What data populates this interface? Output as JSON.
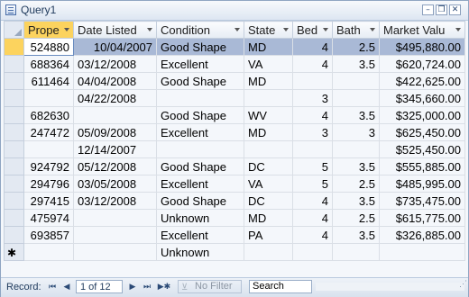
{
  "window": {
    "title": "Query1",
    "minimize": "–",
    "restore": "❐",
    "close": "✕"
  },
  "columns": [
    "Prope",
    "Date Listed",
    "Condition",
    "State",
    "Bed",
    "Bath",
    "Market Valu"
  ],
  "rows": [
    [
      "524880",
      "10/04/2007",
      "Good Shape",
      "MD",
      "4",
      "2.5",
      "$495,880.00"
    ],
    [
      "688364",
      "03/12/2008",
      "Excellent",
      "VA",
      "4",
      "3.5",
      "$620,724.00"
    ],
    [
      "611464",
      "04/04/2008",
      "Good Shape",
      "MD",
      "",
      "",
      "$422,625.00"
    ],
    [
      "",
      "04/22/2008",
      "",
      "",
      "3",
      "",
      "$345,660.00"
    ],
    [
      "682630",
      "",
      "Good Shape",
      "WV",
      "4",
      "3.5",
      "$325,000.00"
    ],
    [
      "247472",
      "05/09/2008",
      "Excellent",
      "MD",
      "3",
      "3",
      "$625,450.00"
    ],
    [
      "",
      "12/14/2007",
      "",
      "",
      "",
      "",
      "$525,450.00"
    ],
    [
      "924792",
      "05/12/2008",
      "Good Shape",
      "DC",
      "5",
      "3.5",
      "$555,885.00"
    ],
    [
      "294796",
      "03/05/2008",
      "Excellent",
      "VA",
      "5",
      "2.5",
      "$485,995.00"
    ],
    [
      "297415",
      "03/12/2008",
      "Good Shape",
      "DC",
      "4",
      "3.5",
      "$735,475.00"
    ],
    [
      "475974",
      "",
      "Unknown",
      "MD",
      "4",
      "2.5",
      "$615,775.00"
    ],
    [
      "693857",
      "",
      "Excellent",
      "PA",
      "4",
      "3.5",
      "$326,885.00"
    ]
  ],
  "new_row": {
    "marker": "✱",
    "condition_default": "Unknown"
  },
  "statusbar": {
    "record_label": "Record:",
    "first": "⏮",
    "prev": "◀",
    "record_position": "1 of 12",
    "next": "▶",
    "last": "⏭",
    "new": "▶✱",
    "filter_icon": "funnel-icon",
    "filter_label": "No Filter",
    "search_placeholder": "Search"
  },
  "colors": {
    "selected_header": "#fcd35e",
    "current_row": "#a9b9d6",
    "border": "#8fa5c2"
  }
}
